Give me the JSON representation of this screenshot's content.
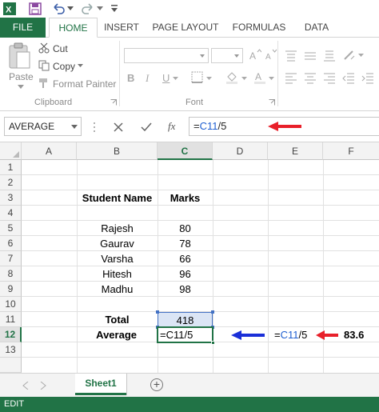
{
  "ribbon_tabs": [
    {
      "label": "FILE"
    },
    {
      "label": "HOME"
    },
    {
      "label": "INSERT"
    },
    {
      "label": "PAGE LAYOUT"
    },
    {
      "label": "FORMULAS"
    },
    {
      "label": "DATA"
    }
  ],
  "clipboard": {
    "paste": "Paste",
    "cut": "Cut",
    "copy": "Copy",
    "format_painter": "Format Painter",
    "group": "Clipboard"
  },
  "font_group": {
    "group": "Font",
    "bold": "B",
    "italic": "I",
    "underline": "U"
  },
  "formula_bar": {
    "name_box": "AVERAGE",
    "fx": "fx",
    "formula_prefix": "=",
    "formula_ref": "C11",
    "formula_suffix": "/5"
  },
  "columns": [
    "A",
    "B",
    "C",
    "D",
    "E",
    "F"
  ],
  "rows": [
    "1",
    "2",
    "3",
    "4",
    "5",
    "6",
    "7",
    "8",
    "9",
    "10",
    "11",
    "12",
    "13"
  ],
  "headers": {
    "name": "Student Name",
    "marks": "Marks"
  },
  "students": [
    {
      "name": "Rajesh",
      "marks": "80"
    },
    {
      "name": "Gaurav",
      "marks": "78"
    },
    {
      "name": "Varsha",
      "marks": "66"
    },
    {
      "name": "Hitesh",
      "marks": "96"
    },
    {
      "name": "Madhu",
      "marks": "98"
    }
  ],
  "total": {
    "label": "Total",
    "value": "418"
  },
  "average": {
    "label": "Average",
    "editing": "=C11/5"
  },
  "annotation": {
    "prefix": "=",
    "ref": "C11",
    "suffix": "/5",
    "result": "83.6"
  },
  "sheet_tab": "Sheet1",
  "add_sheet": "+",
  "status": "EDIT",
  "colors": {
    "excel_green": "#217346",
    "arrow_red": "#e8202a",
    "arrow_blue": "#1a2fd8",
    "ref_blue": "#1f5fd1"
  }
}
